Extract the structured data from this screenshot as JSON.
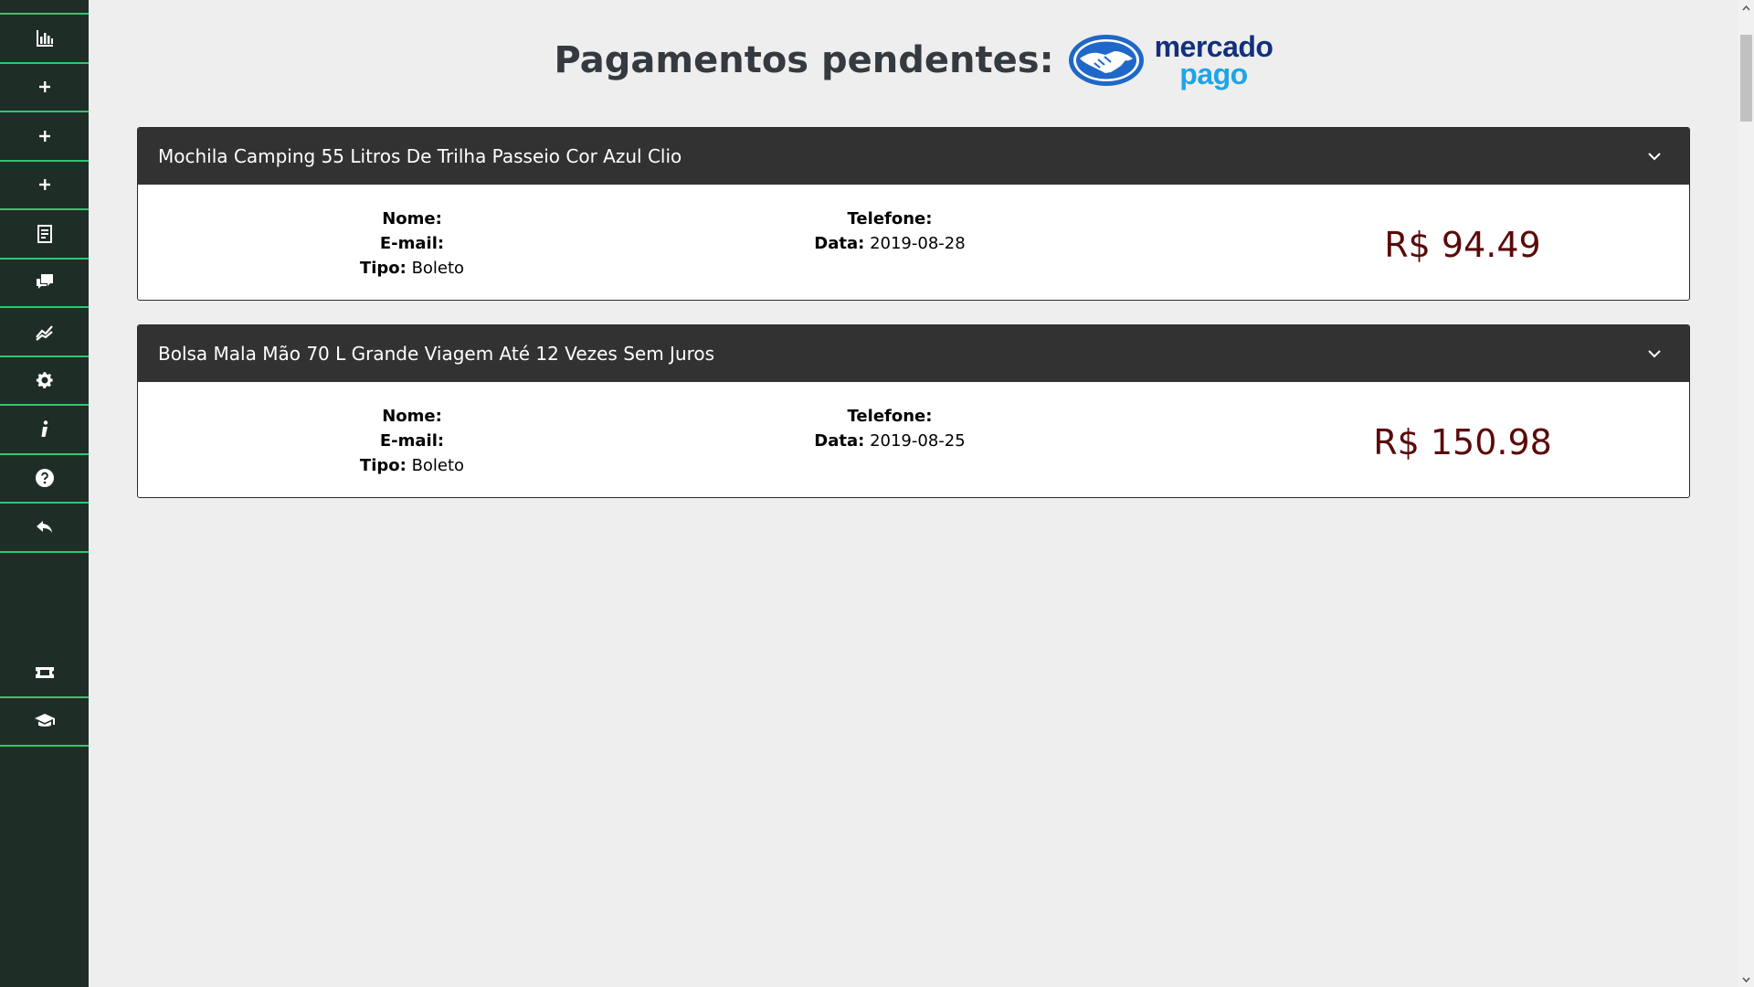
{
  "sidebar": {
    "items": [
      {
        "icon": "bar-chart-icon"
      },
      {
        "icon": "plus-icon"
      },
      {
        "icon": "plus-icon"
      },
      {
        "icon": "plus-icon"
      },
      {
        "icon": "document-icon"
      },
      {
        "icon": "chat-icon"
      },
      {
        "icon": "line-chart-icon"
      },
      {
        "icon": "gear-icon"
      },
      {
        "icon": "info-icon"
      },
      {
        "icon": "help-icon"
      },
      {
        "icon": "reply-icon"
      }
    ],
    "lower_items": [
      {
        "icon": "ticket-icon"
      },
      {
        "icon": "graduation-cap-icon"
      }
    ],
    "colors": {
      "background": "#1f2d27",
      "divider": "#2ec76e"
    }
  },
  "header": {
    "title": "Pagamentos pendentes:",
    "logo": {
      "line1": "mercado",
      "line2": "pago"
    }
  },
  "payments": [
    {
      "product": "Mochila Camping 55 Litros De Trilha Passeio Cor Azul Clio",
      "nome_label": "Nome:",
      "nome_value": "",
      "email_label": "E-mail:",
      "email_value": "",
      "tipo_label": "Tipo:",
      "tipo_value": "Boleto",
      "telefone_label": "Telefone:",
      "telefone_value": "",
      "data_label": "Data:",
      "data_value": "2019-08-28",
      "amount": "R$ 94.49"
    },
    {
      "product": "Bolsa Mala Mão 70 L Grande Viagem Até 12 Vezes Sem Juros",
      "nome_label": "Nome:",
      "nome_value": "",
      "email_label": "E-mail:",
      "email_value": "",
      "tipo_label": "Tipo:",
      "tipo_value": "Boleto",
      "telefone_label": "Telefone:",
      "telefone_value": "",
      "data_label": "Data:",
      "data_value": "2019-08-25",
      "amount": "R$ 150.98"
    }
  ],
  "colors": {
    "amount": "#5a0a0a",
    "card_header": "#323232",
    "page_background": "#eeeeee"
  }
}
